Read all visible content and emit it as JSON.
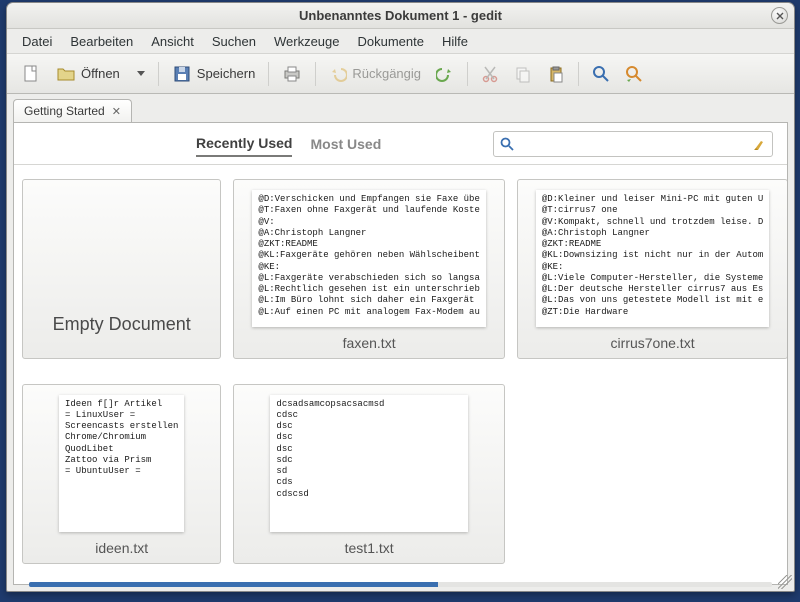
{
  "title": "Unbenanntes Dokument 1 - gedit",
  "menubar": {
    "items": [
      "Datei",
      "Bearbeiten",
      "Ansicht",
      "Suchen",
      "Werkzeuge",
      "Dokumente",
      "Hilfe"
    ]
  },
  "toolbar": {
    "open_label": "Öffnen",
    "save_label": "Speichern",
    "undo_label": "Rückgängig"
  },
  "tab": {
    "label": "Getting Started"
  },
  "dashboard": {
    "tabs": {
      "recent": "Recently Used",
      "most": "Most Used"
    }
  },
  "search": {
    "placeholder": ""
  },
  "cards": [
    {
      "title": "Empty Document",
      "preview": ""
    },
    {
      "title": "faxen.txt",
      "preview": "@D:Verschicken und Empfangen sie Faxe übe\n@T:Faxen ohne Faxgerät und laufende Koste\n@V:\n@A:Christoph Langner\n@ZKT:README\n@KL:Faxgeräte gehören neben Wählscheibent\n@KE:\n@L:Faxgeräte verabschieden sich so langsa\n@L:Rechtlich gesehen ist ein unterschrieb\n@L:Im Büro lohnt sich daher ein Faxgerät\n@L:Auf einen PC mit analogem Fax-Modem au"
    },
    {
      "title": "cirrus7one.txt",
      "preview": "@D:Kleiner und leiser Mini-PC mit guten U\n@T:cirrus7 one\n@V:Kompakt, schnell und trotzdem leise. D\n@A:Christoph Langner\n@ZKT:README\n@KL:Downsizing ist nicht nur in der Autom\n@KE:\n@L:Viele Computer-Hersteller, die Systeme\n@L:Der deutsche Hersteller cirrus7 aus Es\n@L:Das von uns getestete Modell ist mit e\n@ZT:Die Hardware"
    },
    {
      "title": "ideen.txt",
      "preview": "Ideen f[]r Artikel\n= LinuxUser =\nScreencasts erstellen\nChrome/Chromium\nQuodLibet\nZattoo via Prism\n= UbuntuUser ="
    },
    {
      "title": "test1.txt",
      "preview": "dcsadsamcopsacsacmsd\ncdsc\ndsc\ndsc\ndsc\nsdc\nsd\ncds\ncdscsd"
    }
  ]
}
